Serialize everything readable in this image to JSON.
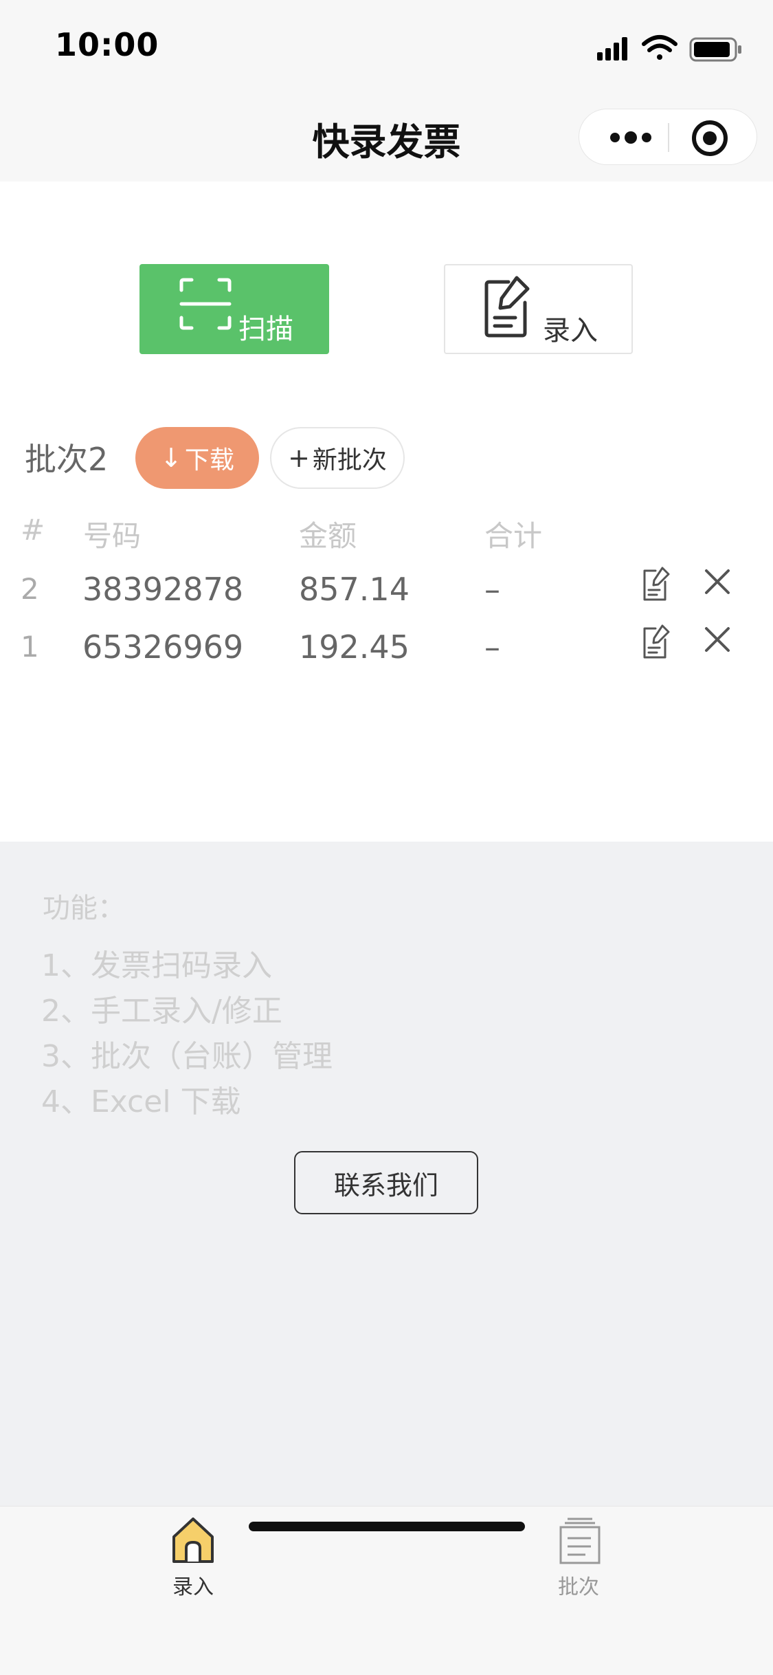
{
  "status_bar": {
    "time": "10:00"
  },
  "nav": {
    "title": "快录发票"
  },
  "actions": {
    "scan_label": "扫描",
    "entry_label": "录入"
  },
  "batch": {
    "title": "批次2",
    "download_label": "下载",
    "new_batch_label": "新批次"
  },
  "table": {
    "headers": {
      "index": "#",
      "number": "号码",
      "amount": "金额",
      "total": "合计"
    },
    "rows": [
      {
        "index": "2",
        "number": "38392878",
        "amount": "857.14",
        "total": "–"
      },
      {
        "index": "1",
        "number": "65326969",
        "amount": "192.45",
        "total": "–"
      }
    ]
  },
  "features": {
    "title": "功能：",
    "items": [
      "1、发票扫码录入",
      "2、手工录入/修正",
      "3、批次（台账）管理",
      "4、Excel 下载"
    ],
    "contact_label": "联系我们"
  },
  "tabbar": {
    "tabs": [
      {
        "label": "录入",
        "icon": "home-icon",
        "active": true
      },
      {
        "label": "批次",
        "icon": "document-list-icon",
        "active": false
      }
    ]
  },
  "colors": {
    "scan_green": "#5ac26a",
    "download_orange": "#ef9871",
    "home_icon_yellow": "#f6cf6a"
  }
}
